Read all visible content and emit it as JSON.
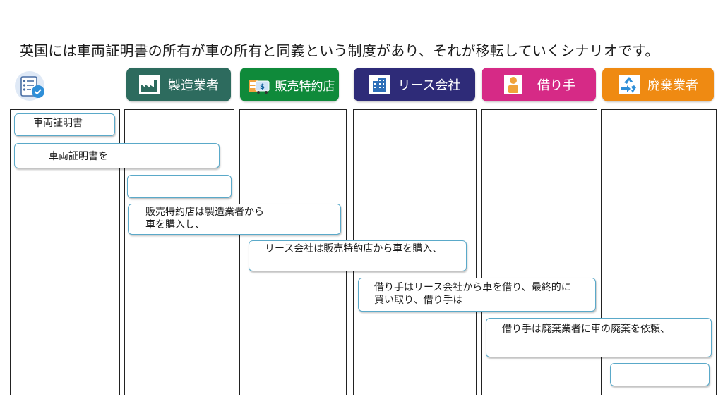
{
  "title": "英国には車両証明書の所有が車の所有と同義という制度があり、それが移転していくシナリオです。",
  "headers": {
    "manufacturer": "製造業者",
    "dealer": "販売特約店",
    "lease": "リース会社",
    "lessee": "借り手",
    "disposal": "廃棄業者"
  },
  "header_colors": {
    "manufacturer": "#2d6b5e",
    "dealer": "#0f8a3a",
    "lease": "#2e2b78",
    "lessee": "#d62a86",
    "disposal": "#ef8a12"
  },
  "icons": {
    "document": "certificate-check-icon",
    "manufacturer": "factory-icon",
    "dealer": "car-dollar-icon",
    "lease": "office-building-icon",
    "lessee": "person-icon",
    "disposal": "recycle-icon"
  },
  "steps": {
    "s1": "車両証明書",
    "s2": "車両証明書を",
    "s3": "",
    "s4": "販売特約店は製造業者から\n車を購入し、",
    "s5": "リース会社は販売特約店から車を購入、",
    "s6": "借り手はリース会社から車を借り、最終的に\n買い取り、借り手は",
    "s7": "借り手は廃棄業者に車の廃棄を依頼、",
    "s8": ""
  }
}
